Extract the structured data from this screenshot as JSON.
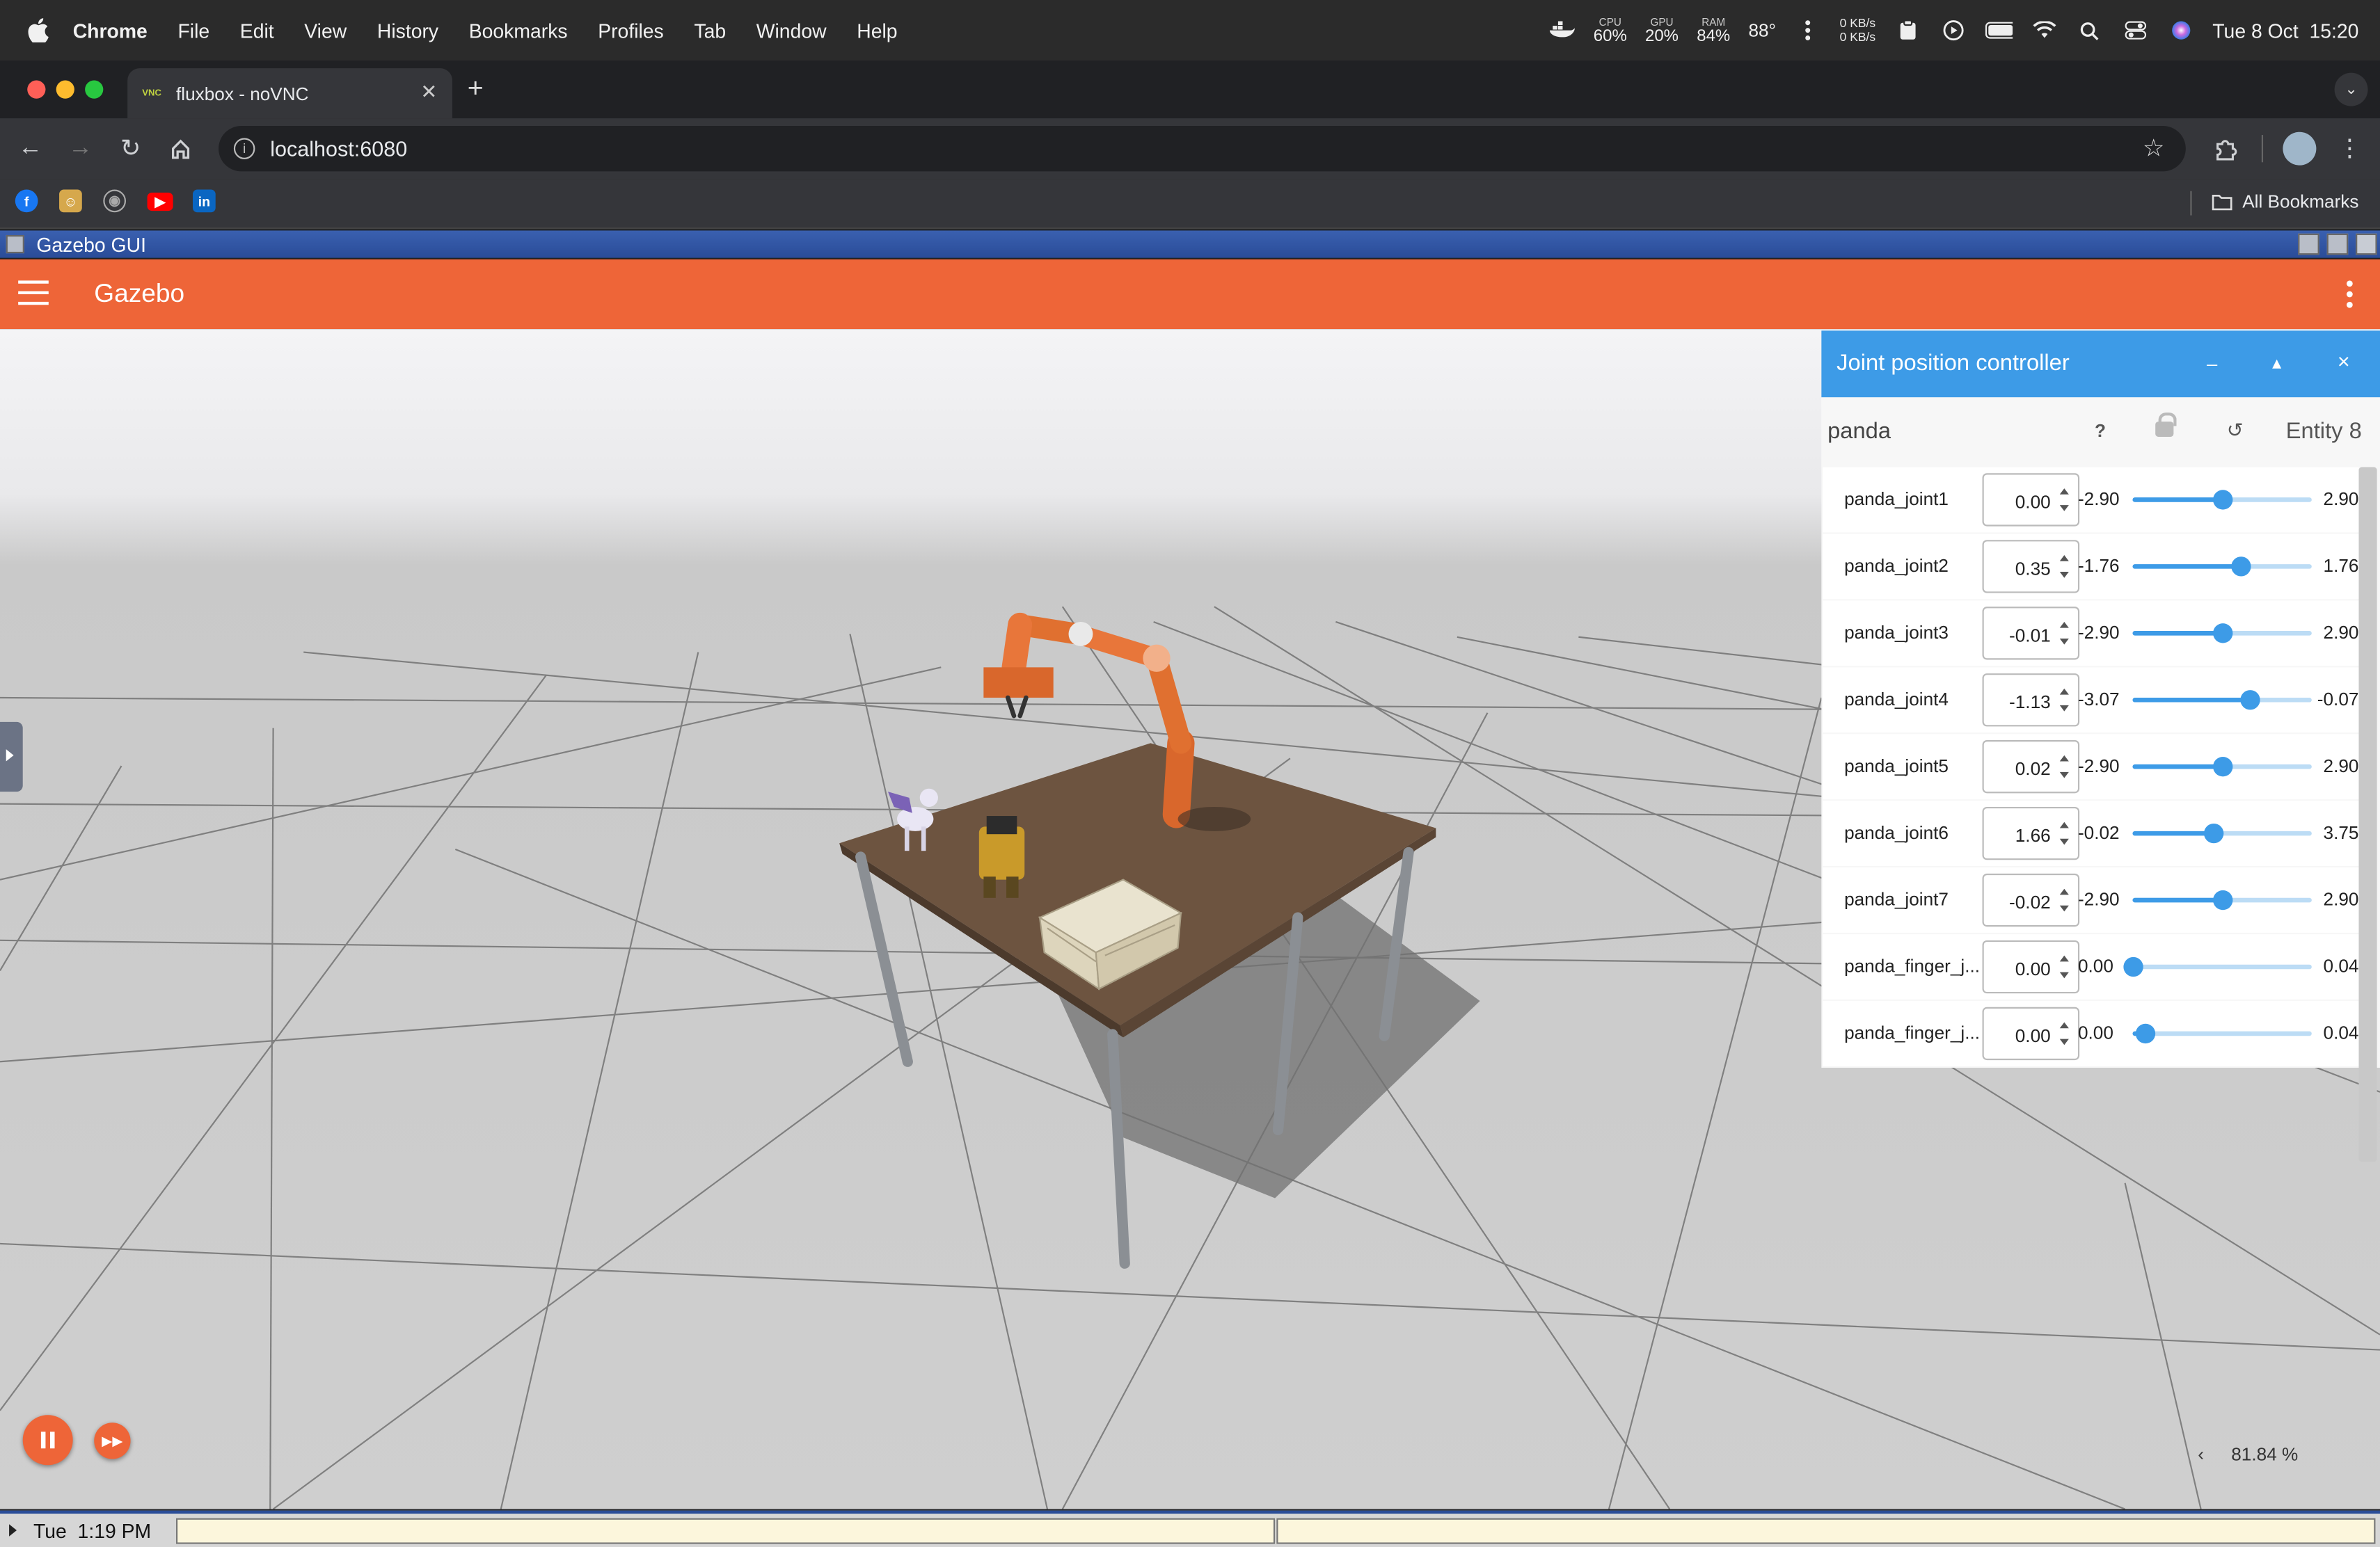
{
  "mac_menubar": {
    "app_name": "Chrome",
    "menus": [
      "File",
      "Edit",
      "View",
      "History",
      "Bookmarks",
      "Profiles",
      "Tab",
      "Window",
      "Help"
    ],
    "stats": [
      {
        "label": "CPU",
        "value": "60%"
      },
      {
        "label": "GPU",
        "value": "20%"
      },
      {
        "label": "RAM",
        "value": "84%"
      }
    ],
    "temperature": "88°",
    "net_up": "0 KB/s",
    "net_down": "0 KB/s",
    "datetime": "Tue 8 Oct  15:20"
  },
  "browser": {
    "tab_title": "fluxbox - noVNC",
    "tab_favicon": "VNC",
    "new_tab": "+",
    "url": "localhost:6080",
    "bookmarks_all": "All Bookmarks",
    "bookmark_icons": [
      "facebook-icon",
      "custom-icon",
      "github-icon",
      "youtube-icon",
      "linkedin-icon"
    ]
  },
  "vnc_window": {
    "title": "Gazebo GUI"
  },
  "gazebo": {
    "app_title": "Gazebo",
    "rtf": "81.84 %",
    "rtf_toggle": "‹",
    "accent": "#ee6538"
  },
  "joint_panel": {
    "title": "Joint position controller",
    "minimize": "_",
    "float": "▴",
    "close": "×",
    "model_name": "panda",
    "help": "?",
    "reset": "↺",
    "entity": "Entity 8",
    "accent": "#3d9be7",
    "joints": [
      {
        "name": "panda_joint1",
        "value": "0.00",
        "min": "-2.90",
        "max": "2.90",
        "level": 0.5
      },
      {
        "name": "panda_joint2",
        "value": "0.35",
        "min": "-1.76",
        "max": "1.76",
        "level": 0.6
      },
      {
        "name": "panda_joint3",
        "value": "-0.01",
        "min": "-2.90",
        "max": "2.90",
        "level": 0.5
      },
      {
        "name": "panda_joint4",
        "value": "-1.13",
        "min": "-3.07",
        "max": "-0.07",
        "level": 0.65
      },
      {
        "name": "panda_joint5",
        "value": "0.02",
        "min": "-2.90",
        "max": "2.90",
        "level": 0.5
      },
      {
        "name": "panda_joint6",
        "value": "1.66",
        "min": "-0.02",
        "max": "3.75",
        "level": 0.45
      },
      {
        "name": "panda_joint7",
        "value": "-0.02",
        "min": "-2.90",
        "max": "2.90",
        "level": 0.5
      },
      {
        "name": "panda_finger_j...",
        "value": "0.00",
        "min": "0.00",
        "max": "0.04",
        "level": 0.0
      },
      {
        "name": "panda_finger_j...",
        "value": "0.00",
        "min": "0.00",
        "max": "0.04",
        "level": 0.07
      }
    ]
  },
  "taskbar": {
    "clock": "Tue  1:19 PM",
    "task1": "",
    "task2": ""
  }
}
